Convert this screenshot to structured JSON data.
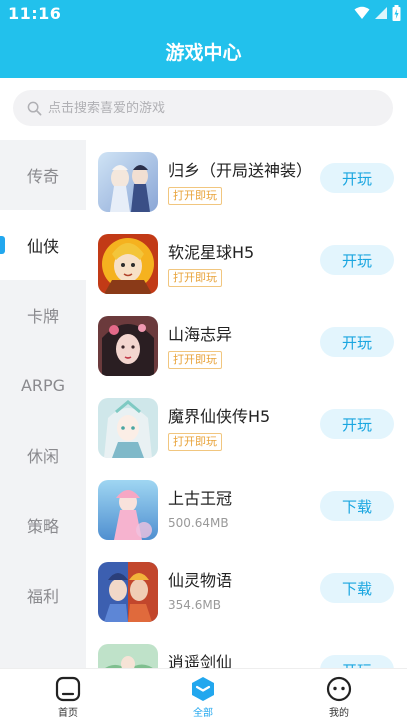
{
  "status_bar": {
    "time": "11:16"
  },
  "header": {
    "title": "游戏中心"
  },
  "search": {
    "placeholder": "点击搜索喜爱的游戏"
  },
  "sidebar": {
    "categories": [
      {
        "label": "传奇"
      },
      {
        "label": "仙侠"
      },
      {
        "label": "卡牌"
      },
      {
        "label": "ARPG"
      },
      {
        "label": "休闲"
      },
      {
        "label": "策略"
      },
      {
        "label": "福利"
      }
    ],
    "active": "仙侠"
  },
  "games": [
    {
      "name": "归乡（开局送神装）",
      "tag": "打开即玩",
      "size": "",
      "button": "开玩",
      "icon": "game-icon-guixiang"
    },
    {
      "name": "软泥星球H5",
      "tag": "打开即玩",
      "size": "",
      "button": "开玩",
      "icon": "game-icon-ruanni"
    },
    {
      "name": "山海志异",
      "tag": "打开即玩",
      "size": "",
      "button": "开玩",
      "icon": "game-icon-shanhai"
    },
    {
      "name": "魔界仙侠传H5",
      "tag": "打开即玩",
      "size": "",
      "button": "开玩",
      "icon": "game-icon-mojie"
    },
    {
      "name": "上古王冠",
      "tag": "",
      "size": "500.64MB",
      "button": "下载",
      "icon": "game-icon-shanggu"
    },
    {
      "name": "仙灵物语",
      "tag": "",
      "size": "354.6MB",
      "button": "下载",
      "icon": "game-icon-xianling"
    },
    {
      "name": "逍遥剑仙",
      "tag": "",
      "size": "",
      "button": "开玩",
      "icon": "game-icon-xiaoyao"
    }
  ],
  "bottom_nav": {
    "items": [
      {
        "label": "首页",
        "icon": "home-icon"
      },
      {
        "label": "全部",
        "icon": "all-icon"
      },
      {
        "label": "我的",
        "icon": "profile-icon"
      }
    ],
    "active": "全部"
  },
  "colors": {
    "accent": "#22c1ec",
    "button_bg": "#e3f5fd",
    "button_text": "#1aa6e0",
    "tag": "#e8a33a"
  }
}
